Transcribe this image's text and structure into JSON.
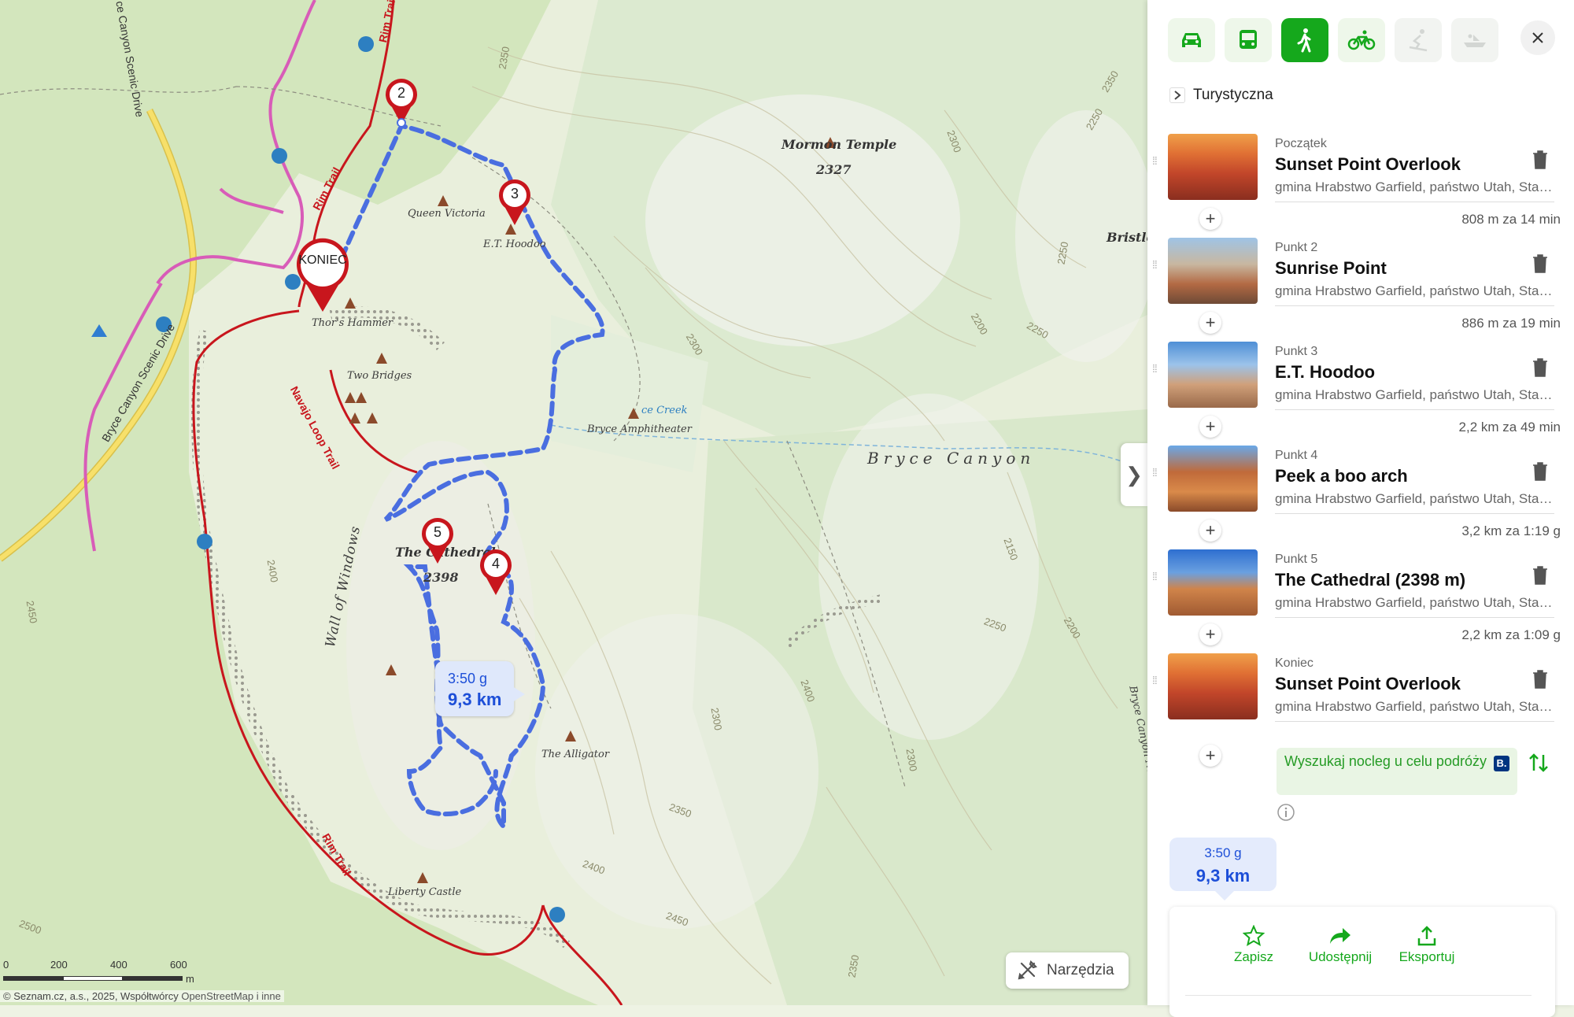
{
  "map": {
    "peaks_and_places": {
      "mormon_temple": "Mormon Temple",
      "mormon_temple_elev": "2327",
      "bristlecone": "Bristle",
      "queen_victoria": "Queen Victoria",
      "et_hoodoo": "E.T. Hoodoo",
      "thors_hammer": "Thor's Hammer",
      "two_bridges": "Two Bridges",
      "creek": "ce Creek",
      "amphitheater": "Bryce Amphitheater",
      "bryce_canyon": "Bryce Canyon",
      "the_cathedral": "The Cathedral",
      "cathedral_elev": "2398",
      "the_alligator": "The Alligator",
      "liberty_castle": "Liberty Castle",
      "wall_of_windows": "Wall of Windows",
      "bryce_canyon_np": "Bryce Canyon Na"
    },
    "trails": {
      "rim_trail_top": "Rim Trail",
      "rim_trail_mid": "Rim Trail",
      "rim_trail_bottom": "Rim Trail",
      "navajo_loop": "Navajo Loop Trail",
      "scenic_drive_top": "ce Canyon Scenic Drive",
      "scenic_drive_left": "Bryce Canyon Scenic Drive"
    },
    "contours": [
      "2350",
      "2300",
      "2300",
      "2250",
      "2350",
      "2300",
      "2250",
      "2200",
      "2250",
      "2150",
      "2250",
      "2200",
      "2400",
      "2300",
      "2350",
      "2400",
      "2450",
      "2350",
      "2450",
      "2400",
      "2500"
    ],
    "pins": {
      "p2": "2",
      "p3": "3",
      "p4": "4",
      "p5": "5",
      "end": "KONIEC"
    },
    "route_bubble": {
      "time": "3:50 g",
      "distance": "9,3 km"
    },
    "scale": {
      "t0": "0",
      "t1": "200",
      "t2": "400",
      "t3": "600",
      "unit": "m"
    },
    "attribution": {
      "text": "© Seznam.cz, a.s., 2025, Współtwórcy",
      "link": "OpenStreetMap i inne"
    },
    "tools_label": "Narzędzia",
    "collapse_icon": "chevron-right-icon"
  },
  "panel": {
    "modes": [
      "car-icon",
      "bus-icon",
      "walk-icon",
      "bike-icon",
      "ski-icon",
      "boat-icon"
    ],
    "active_mode": "walk-icon",
    "route_type": "Turystyczna",
    "waypoints": [
      {
        "label": "Początek",
        "name": "Sunset Point Overlook",
        "address": "gmina Hrabstwo Garfield, państwo Utah, Stany Zjednoczone"
      },
      {
        "label": "Punkt 2",
        "name": "Sunrise Point",
        "address": "gmina Hrabstwo Garfield, państwo Utah, Stany Zjednoczone"
      },
      {
        "label": "Punkt 3",
        "name": "E.T. Hoodoo",
        "address": "gmina Hrabstwo Garfield, państwo Utah, Stany Zjednoczone"
      },
      {
        "label": "Punkt 4",
        "name": "Peek a boo arch",
        "address": "gmina Hrabstwo Garfield, państwo Utah, Stany Zjednoczone"
      },
      {
        "label": "Punkt 5",
        "name": "The Cathedral (2398 m)",
        "address": "gmina Hrabstwo Garfield, państwo Utah, Stany Zjednoczone"
      },
      {
        "label": "Koniec",
        "name": "Sunset Point Overlook",
        "address": "gmina Hrabstwo Garfield, państwo Utah, Stany Zjednoczone"
      }
    ],
    "segments": [
      "808 m za 14 min",
      "886 m za 19 min",
      "2,2 km za 49 min",
      "3,2 km za 1:19 g",
      "2,2 km za 1:09 g"
    ],
    "booking_text": "Wyszukaj nocleg u celu podróży",
    "booking_badge": "B.",
    "summary": {
      "time": "3:50 g",
      "distance": "9,3 km"
    },
    "actions": {
      "save": "Zapisz",
      "share": "Udostępnij",
      "export": "Eksportuj"
    }
  },
  "colors": {
    "route": "#4a6ee0",
    "trail": "#c8161d",
    "road_pink": "#d85cb8",
    "accent_green": "#15a81c"
  }
}
